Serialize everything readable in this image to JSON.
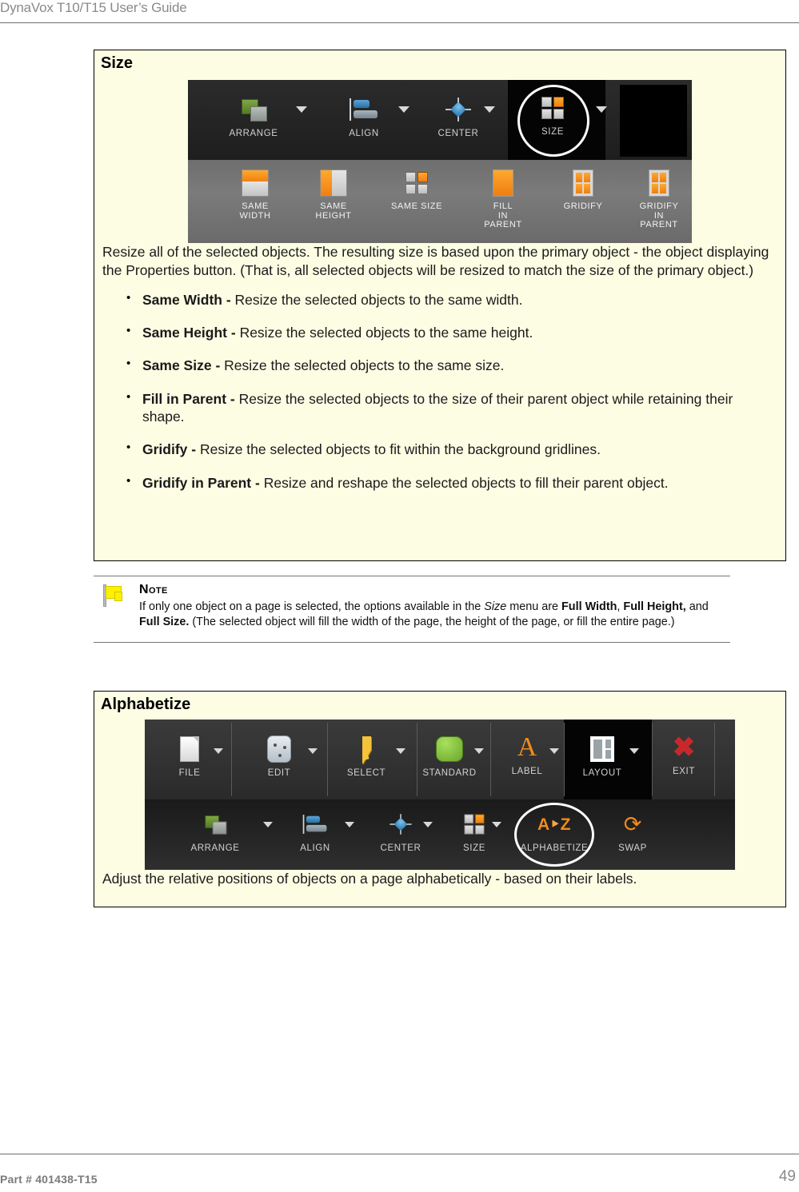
{
  "header": {
    "title": "DynaVox T10/T15 User’s Guide"
  },
  "footer": {
    "part_number": "Part # 401438-T15",
    "page_number": "49"
  },
  "size_section": {
    "title": "Size",
    "description": "Resize all of the selected objects. The resulting size is based upon the primary object - the object displaying the Properties button. (That is, all selected objects will be resized to match the size of the primary object.)",
    "bullets": [
      {
        "term": "Same Width - ",
        "text": "Resize the selected objects to the same width."
      },
      {
        "term": "Same Height - ",
        "text": "Resize the selected objects to the same height."
      },
      {
        "term": "Same Size - ",
        "text": "Resize the selected objects to the same size."
      },
      {
        "term": "Fill in Parent - ",
        "text": "Resize the selected objects to the size of their parent object while retaining their shape."
      },
      {
        "term": "Gridify - ",
        "text": "Resize the selected objects to fit within the background gridlines."
      },
      {
        "term": "Gridify in Parent - ",
        "text": "Resize and reshape the selected objects to fill their parent object."
      }
    ],
    "toolbar": {
      "row_top": [
        {
          "label": "ARRANGE",
          "icon": "arrange-icon"
        },
        {
          "label": "ALIGN",
          "icon": "align-icon"
        },
        {
          "label": "CENTER",
          "icon": "center-icon"
        },
        {
          "label": "SIZE",
          "icon": "size-grid-icon",
          "highlighted": true
        }
      ],
      "row_bottom": [
        {
          "label": "SAME\nWIDTH",
          "icon": "same-width-icon"
        },
        {
          "label": "SAME\nHEIGHT",
          "icon": "same-height-icon"
        },
        {
          "label": "SAME SIZE",
          "icon": "same-size-icon"
        },
        {
          "label": "FILL\nIN\nPARENT",
          "icon": "fill-in-parent-icon"
        },
        {
          "label": "GRIDIFY",
          "icon": "gridify-icon"
        },
        {
          "label": "GRIDIFY\nIN\nPARENT",
          "icon": "gridify-in-parent-icon"
        }
      ]
    }
  },
  "note": {
    "title": "Note",
    "segments": [
      {
        "text": "If only one object on a page is selected, the options available in the ",
        "style": "normal"
      },
      {
        "text": "Size",
        "style": "italic"
      },
      {
        "text": " menu are ",
        "style": "normal"
      },
      {
        "text": "Full Width",
        "style": "bold"
      },
      {
        "text": ", ",
        "style": "normal"
      },
      {
        "text": "Full Height,",
        "style": "bold"
      },
      {
        "text": " and ",
        "style": "normal"
      },
      {
        "text": "Full Size.",
        "style": "bold"
      },
      {
        "text": " (The selected object will fill the width of the page, the height of the page, or fill the entire page.)",
        "style": "normal"
      }
    ]
  },
  "alphabetize_section": {
    "title": "Alphabetize",
    "description": "Adjust the relative positions of objects on a page alphabetically - based on their labels.",
    "toolbar": {
      "row_top": [
        {
          "label": "FILE",
          "icon": "file-icon"
        },
        {
          "label": "EDIT",
          "icon": "edit-icon"
        },
        {
          "label": "SELECT",
          "icon": "cursor-icon"
        },
        {
          "label": "STANDARD",
          "icon": "green-shape-icon"
        },
        {
          "label": "LABEL",
          "icon": "letter-a-icon"
        },
        {
          "label": "LAYOUT",
          "icon": "layout-icon",
          "highlighted": true
        },
        {
          "label": "EXIT",
          "icon": "red-x-icon"
        }
      ],
      "row_bottom": [
        {
          "label": "ARRANGE",
          "icon": "arrange-icon"
        },
        {
          "label": "ALIGN",
          "icon": "align-icon"
        },
        {
          "label": "CENTER",
          "icon": "center-icon"
        },
        {
          "label": "SIZE",
          "icon": "size-grid-icon"
        },
        {
          "label": "ALPHABETIZE",
          "icon": "a-to-z-icon",
          "highlighted": true
        },
        {
          "label": "SWAP",
          "icon": "swap-arrows-icon"
        }
      ]
    }
  },
  "colors": {
    "box_background": "#FDFDE4",
    "accent_orange": "#EF8B1C",
    "header_gray": "#8A8A8A",
    "toolbar_dark": "#1C1C1C",
    "flag_yellow": "#FFEF00"
  }
}
